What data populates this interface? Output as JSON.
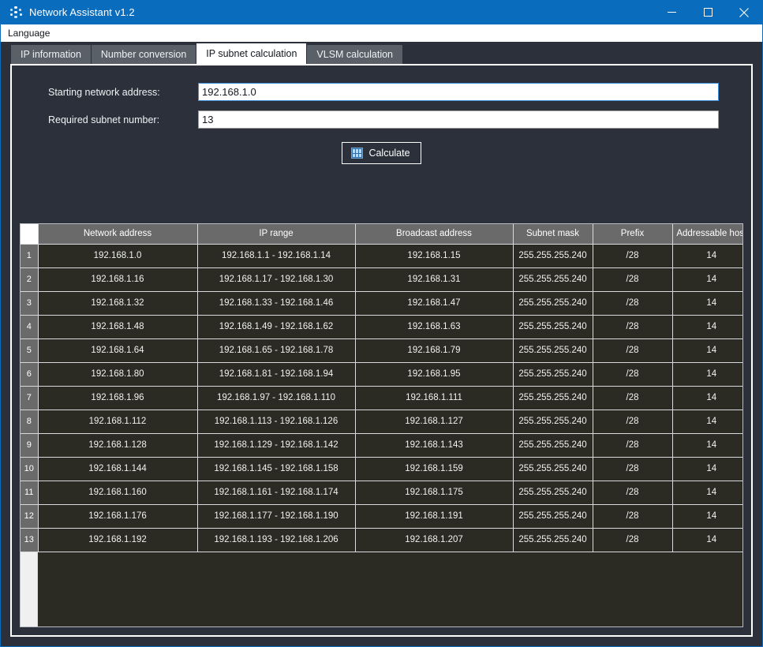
{
  "window": {
    "title": "Network Assistant v1.2",
    "icon": "network-nodes-icon",
    "controls": {
      "minimize": "minimize-icon",
      "maximize": "maximize-icon",
      "close": "close-icon"
    },
    "accent_color": "#0a6cbd",
    "panel_bg": "#2b303b"
  },
  "menubar": {
    "items": [
      {
        "label": "Language"
      }
    ]
  },
  "tabs": [
    {
      "label": "IP information",
      "active": false
    },
    {
      "label": "Number conversion",
      "active": false
    },
    {
      "label": "IP subnet calculation",
      "active": true
    },
    {
      "label": "VLSM calculation",
      "active": false
    }
  ],
  "form": {
    "fields": [
      {
        "label": "Starting network address:",
        "value": "192.168.1.0",
        "placeholder": "",
        "focused": true
      },
      {
        "label": "Required subnet number:",
        "value": "13",
        "placeholder": "",
        "focused": false
      }
    ],
    "calculate_button": {
      "label": "Calculate",
      "icon": "calculator-binary-icon"
    }
  },
  "table": {
    "columns": [
      "",
      "Network address",
      "IP range",
      "Broadcast address",
      "Subnet mask",
      "Prefix",
      "Addressable host"
    ],
    "rows": [
      {
        "n": "1",
        "network": "192.168.1.0",
        "range": "192.168.1.1 - 192.168.1.14",
        "broadcast": "192.168.1.15",
        "mask": "255.255.255.240",
        "prefix": "/28",
        "hosts": "14"
      },
      {
        "n": "2",
        "network": "192.168.1.16",
        "range": "192.168.1.17 - 192.168.1.30",
        "broadcast": "192.168.1.31",
        "mask": "255.255.255.240",
        "prefix": "/28",
        "hosts": "14"
      },
      {
        "n": "3",
        "network": "192.168.1.32",
        "range": "192.168.1.33 - 192.168.1.46",
        "broadcast": "192.168.1.47",
        "mask": "255.255.255.240",
        "prefix": "/28",
        "hosts": "14"
      },
      {
        "n": "4",
        "network": "192.168.1.48",
        "range": "192.168.1.49 - 192.168.1.62",
        "broadcast": "192.168.1.63",
        "mask": "255.255.255.240",
        "prefix": "/28",
        "hosts": "14"
      },
      {
        "n": "5",
        "network": "192.168.1.64",
        "range": "192.168.1.65 - 192.168.1.78",
        "broadcast": "192.168.1.79",
        "mask": "255.255.255.240",
        "prefix": "/28",
        "hosts": "14"
      },
      {
        "n": "6",
        "network": "192.168.1.80",
        "range": "192.168.1.81 - 192.168.1.94",
        "broadcast": "192.168.1.95",
        "mask": "255.255.255.240",
        "prefix": "/28",
        "hosts": "14"
      },
      {
        "n": "7",
        "network": "192.168.1.96",
        "range": "192.168.1.97 - 192.168.1.110",
        "broadcast": "192.168.1.111",
        "mask": "255.255.255.240",
        "prefix": "/28",
        "hosts": "14"
      },
      {
        "n": "8",
        "network": "192.168.1.112",
        "range": "192.168.1.113 - 192.168.1.126",
        "broadcast": "192.168.1.127",
        "mask": "255.255.255.240",
        "prefix": "/28",
        "hosts": "14"
      },
      {
        "n": "9",
        "network": "192.168.1.128",
        "range": "192.168.1.129 - 192.168.1.142",
        "broadcast": "192.168.1.143",
        "mask": "255.255.255.240",
        "prefix": "/28",
        "hosts": "14"
      },
      {
        "n": "10",
        "network": "192.168.1.144",
        "range": "192.168.1.145 - 192.168.1.158",
        "broadcast": "192.168.1.159",
        "mask": "255.255.255.240",
        "prefix": "/28",
        "hosts": "14"
      },
      {
        "n": "11",
        "network": "192.168.1.160",
        "range": "192.168.1.161 - 192.168.1.174",
        "broadcast": "192.168.1.175",
        "mask": "255.255.255.240",
        "prefix": "/28",
        "hosts": "14"
      },
      {
        "n": "12",
        "network": "192.168.1.176",
        "range": "192.168.1.177 - 192.168.1.190",
        "broadcast": "192.168.1.191",
        "mask": "255.255.255.240",
        "prefix": "/28",
        "hosts": "14"
      },
      {
        "n": "13",
        "network": "192.168.1.192",
        "range": "192.168.1.193 - 192.168.1.206",
        "broadcast": "192.168.1.207",
        "mask": "255.255.255.240",
        "prefix": "/28",
        "hosts": "14"
      }
    ]
  }
}
